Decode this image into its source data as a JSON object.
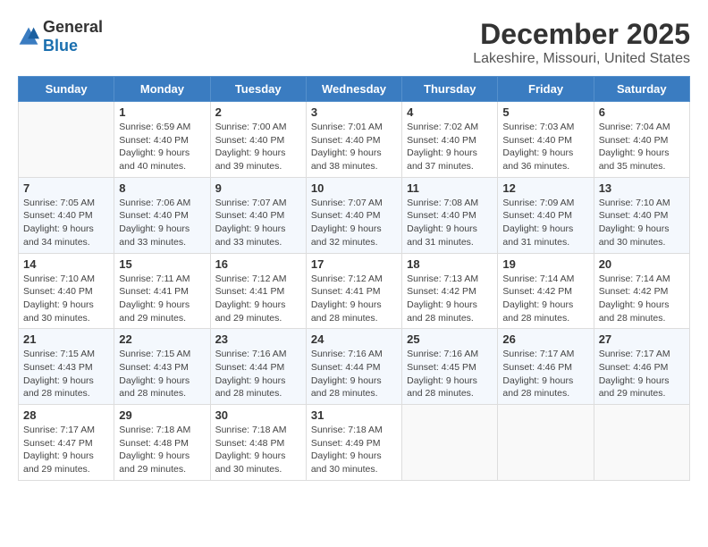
{
  "logo": {
    "general": "General",
    "blue": "Blue"
  },
  "title": "December 2025",
  "location": "Lakeshire, Missouri, United States",
  "days_of_week": [
    "Sunday",
    "Monday",
    "Tuesday",
    "Wednesday",
    "Thursday",
    "Friday",
    "Saturday"
  ],
  "weeks": [
    [
      {
        "day": "",
        "info": ""
      },
      {
        "day": "1",
        "info": "Sunrise: 6:59 AM\nSunset: 4:40 PM\nDaylight: 9 hours\nand 40 minutes."
      },
      {
        "day": "2",
        "info": "Sunrise: 7:00 AM\nSunset: 4:40 PM\nDaylight: 9 hours\nand 39 minutes."
      },
      {
        "day": "3",
        "info": "Sunrise: 7:01 AM\nSunset: 4:40 PM\nDaylight: 9 hours\nand 38 minutes."
      },
      {
        "day": "4",
        "info": "Sunrise: 7:02 AM\nSunset: 4:40 PM\nDaylight: 9 hours\nand 37 minutes."
      },
      {
        "day": "5",
        "info": "Sunrise: 7:03 AM\nSunset: 4:40 PM\nDaylight: 9 hours\nand 36 minutes."
      },
      {
        "day": "6",
        "info": "Sunrise: 7:04 AM\nSunset: 4:40 PM\nDaylight: 9 hours\nand 35 minutes."
      }
    ],
    [
      {
        "day": "7",
        "info": "Sunrise: 7:05 AM\nSunset: 4:40 PM\nDaylight: 9 hours\nand 34 minutes."
      },
      {
        "day": "8",
        "info": "Sunrise: 7:06 AM\nSunset: 4:40 PM\nDaylight: 9 hours\nand 33 minutes."
      },
      {
        "day": "9",
        "info": "Sunrise: 7:07 AM\nSunset: 4:40 PM\nDaylight: 9 hours\nand 33 minutes."
      },
      {
        "day": "10",
        "info": "Sunrise: 7:07 AM\nSunset: 4:40 PM\nDaylight: 9 hours\nand 32 minutes."
      },
      {
        "day": "11",
        "info": "Sunrise: 7:08 AM\nSunset: 4:40 PM\nDaylight: 9 hours\nand 31 minutes."
      },
      {
        "day": "12",
        "info": "Sunrise: 7:09 AM\nSunset: 4:40 PM\nDaylight: 9 hours\nand 31 minutes."
      },
      {
        "day": "13",
        "info": "Sunrise: 7:10 AM\nSunset: 4:40 PM\nDaylight: 9 hours\nand 30 minutes."
      }
    ],
    [
      {
        "day": "14",
        "info": "Sunrise: 7:10 AM\nSunset: 4:40 PM\nDaylight: 9 hours\nand 30 minutes."
      },
      {
        "day": "15",
        "info": "Sunrise: 7:11 AM\nSunset: 4:41 PM\nDaylight: 9 hours\nand 29 minutes."
      },
      {
        "day": "16",
        "info": "Sunrise: 7:12 AM\nSunset: 4:41 PM\nDaylight: 9 hours\nand 29 minutes."
      },
      {
        "day": "17",
        "info": "Sunrise: 7:12 AM\nSunset: 4:41 PM\nDaylight: 9 hours\nand 28 minutes."
      },
      {
        "day": "18",
        "info": "Sunrise: 7:13 AM\nSunset: 4:42 PM\nDaylight: 9 hours\nand 28 minutes."
      },
      {
        "day": "19",
        "info": "Sunrise: 7:14 AM\nSunset: 4:42 PM\nDaylight: 9 hours\nand 28 minutes."
      },
      {
        "day": "20",
        "info": "Sunrise: 7:14 AM\nSunset: 4:42 PM\nDaylight: 9 hours\nand 28 minutes."
      }
    ],
    [
      {
        "day": "21",
        "info": "Sunrise: 7:15 AM\nSunset: 4:43 PM\nDaylight: 9 hours\nand 28 minutes."
      },
      {
        "day": "22",
        "info": "Sunrise: 7:15 AM\nSunset: 4:43 PM\nDaylight: 9 hours\nand 28 minutes."
      },
      {
        "day": "23",
        "info": "Sunrise: 7:16 AM\nSunset: 4:44 PM\nDaylight: 9 hours\nand 28 minutes."
      },
      {
        "day": "24",
        "info": "Sunrise: 7:16 AM\nSunset: 4:44 PM\nDaylight: 9 hours\nand 28 minutes."
      },
      {
        "day": "25",
        "info": "Sunrise: 7:16 AM\nSunset: 4:45 PM\nDaylight: 9 hours\nand 28 minutes."
      },
      {
        "day": "26",
        "info": "Sunrise: 7:17 AM\nSunset: 4:46 PM\nDaylight: 9 hours\nand 28 minutes."
      },
      {
        "day": "27",
        "info": "Sunrise: 7:17 AM\nSunset: 4:46 PM\nDaylight: 9 hours\nand 29 minutes."
      }
    ],
    [
      {
        "day": "28",
        "info": "Sunrise: 7:17 AM\nSunset: 4:47 PM\nDaylight: 9 hours\nand 29 minutes."
      },
      {
        "day": "29",
        "info": "Sunrise: 7:18 AM\nSunset: 4:48 PM\nDaylight: 9 hours\nand 29 minutes."
      },
      {
        "day": "30",
        "info": "Sunrise: 7:18 AM\nSunset: 4:48 PM\nDaylight: 9 hours\nand 30 minutes."
      },
      {
        "day": "31",
        "info": "Sunrise: 7:18 AM\nSunset: 4:49 PM\nDaylight: 9 hours\nand 30 minutes."
      },
      {
        "day": "",
        "info": ""
      },
      {
        "day": "",
        "info": ""
      },
      {
        "day": "",
        "info": ""
      }
    ]
  ]
}
